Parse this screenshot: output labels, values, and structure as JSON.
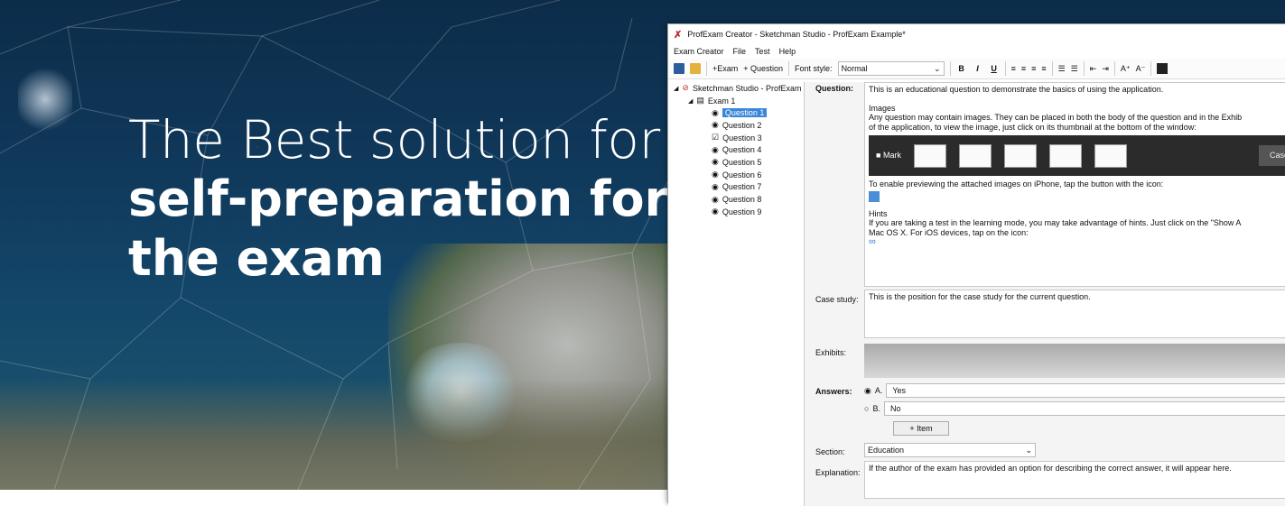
{
  "headline": {
    "line1": "The Best solution for",
    "line2": "self-preparation for",
    "line3": "the exam"
  },
  "window": {
    "title": "ProfExam Creator - Sketchman Studio - ProfExam Example*",
    "menu": [
      "Exam Creator",
      "File",
      "Test",
      "Help"
    ],
    "toolbar": {
      "add_exam": "+Exam",
      "add_question": "+ Question",
      "font_style_label": "Font style:",
      "font_style_value": "Normal",
      "bold": "B",
      "italic": "I",
      "underline": "U"
    },
    "tree": {
      "root": "Sketchman Studio - ProfExam",
      "exam": "Exam 1",
      "questions": [
        "Question 1",
        "Question 2",
        "Question 3",
        "Question 4",
        "Question 5",
        "Question 6",
        "Question 7",
        "Question 8",
        "Question 9"
      ]
    },
    "question": {
      "label": "Question:",
      "intro": "This is an educational question to demonstrate the basics of using the application.",
      "images_heading": "Images",
      "images_text": "Any question may contain images. They can be placed in both the body of the question and in the Exhib",
      "images_text2": "of the application, to view the image, just click on its thumbnail at the bottom of the window:",
      "mark_label": "Mark",
      "case_button": "Case St",
      "iphone_text": "To enable previewing the attached images on iPhone, tap the button with the icon:",
      "hints_heading": "Hints",
      "hints_text": "If you are taking a test in the learning mode, you may take advantage of hints. Just click on the \"Show A",
      "hints_text2": "Mac OS X. For iOS devices, tap on the icon:"
    },
    "case_study": {
      "label": "Case study:",
      "text": "This is the position for the case study for the current question."
    },
    "exhibits_label": "Exhibits:",
    "answers": {
      "label": "Answers:",
      "items": [
        {
          "letter": "A.",
          "text": "Yes"
        },
        {
          "letter": "B.",
          "text": "No"
        }
      ],
      "add_item": "+ Item"
    },
    "section": {
      "label": "Section:",
      "value": "Education"
    },
    "explanation": {
      "label": "Explanation:",
      "text": "If the author of the exam has provided an option for describing the correct answer, it will appear here."
    }
  }
}
